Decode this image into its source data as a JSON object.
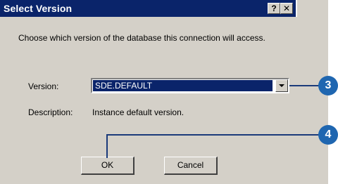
{
  "dialog": {
    "title": "Select Version",
    "help_label": "?",
    "close_label": "✕",
    "prompt": "Choose which version of the database this connection will access.",
    "version_label": "Version:",
    "version_value": "SDE.DEFAULT",
    "description_label": "Description:",
    "description_value": "Instance default version.",
    "ok_label": "OK",
    "cancel_label": "Cancel"
  },
  "callouts": {
    "step3": "3",
    "step4": "4"
  },
  "colors": {
    "titlebar": "#0a246a",
    "dialog_bg": "#d4d0c8",
    "callout": "#1f66b0"
  }
}
